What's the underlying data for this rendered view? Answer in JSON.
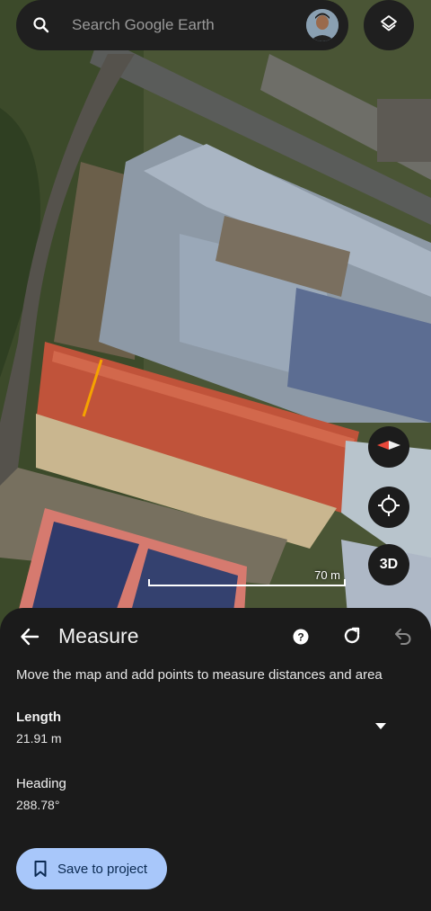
{
  "search": {
    "placeholder": "Search Google Earth"
  },
  "map": {
    "scale_label": "70 m",
    "view_mode_label": "3D",
    "measure_line_color": "#f5a300"
  },
  "measure_panel": {
    "title": "Measure",
    "instructions": "Move the map and add points to measure distances and area",
    "length": {
      "label": "Length",
      "value": "21.91 m"
    },
    "heading": {
      "label": "Heading",
      "value": "288.78°"
    },
    "save_button_label": "Save to project"
  },
  "colors": {
    "panel_bg": "#1b1b1b",
    "save_button_bg": "#a8c7fa",
    "compass_red": "#e8483a"
  }
}
